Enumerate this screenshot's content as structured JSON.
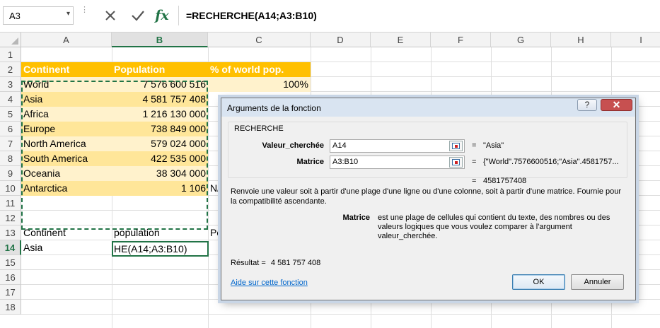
{
  "formula_bar": {
    "name_box": "A3",
    "formula": "=RECHERCHE(A14;A3:B10)"
  },
  "icons": {
    "name_box_dropdown": "▾",
    "cancel": "✕",
    "enter": "✓",
    "fx": "fx",
    "dots": "⋮"
  },
  "columns": [
    "A",
    "B",
    "C",
    "D",
    "E",
    "F",
    "G",
    "H",
    "I"
  ],
  "rows": [
    "1",
    "2",
    "3",
    "4",
    "5",
    "6",
    "7",
    "8",
    "9",
    "10",
    "11",
    "12",
    "13",
    "14",
    "15",
    "16",
    "17",
    "18"
  ],
  "table": {
    "headers": [
      "Continent",
      "Population",
      "% of world pop."
    ],
    "rows": [
      {
        "continent": "World",
        "population": "7 576 600 516",
        "percent": "100%"
      },
      {
        "continent": "Asia",
        "population": "4 581 757 408",
        "percent": ""
      },
      {
        "continent": "Africa",
        "population": "1 216 130 000",
        "percent": ""
      },
      {
        "continent": "Europe",
        "population": "738 849 000",
        "percent": ""
      },
      {
        "continent": "North America",
        "population": "579 024 000",
        "percent": ""
      },
      {
        "continent": "South America",
        "population": "422 535 000",
        "percent": ""
      },
      {
        "continent": "Oceania",
        "population": "38 304 000",
        "percent": ""
      },
      {
        "continent": "Antarctica",
        "population": "1 106",
        "percent": "N/"
      }
    ],
    "colors": {
      "header": "#ffc000",
      "band_light": "#fff2cc",
      "band_dark": "#ffe699"
    }
  },
  "lookup": {
    "label_continent": "Continent",
    "label_population": "population",
    "label_c13": "Po",
    "value_continent": "Asia",
    "active_cell_text": "HE(A14;A3:B10)"
  },
  "dialog": {
    "title": "Arguments de la fonction",
    "help_button": "?",
    "close_button": "✕",
    "function_name": "RECHERCHE",
    "args": [
      {
        "label": "Valeur_cherchée",
        "input": "A14",
        "value": "\"Asia\""
      },
      {
        "label": "Matrice",
        "input": "A3:B10",
        "value": "{\"World\".7576600516;\"Asia\".4581757..."
      }
    ],
    "equals": "=",
    "result_value": "4581757408",
    "description": "Renvoie une valeur soit à partir d'une plage d'une ligne ou d'une colonne, soit à partir d'une matrice. Fournie pour la compatibilité ascendante.",
    "arg_desc_name": "Matrice",
    "arg_desc_text": "est une plage de cellules qui contient du texte, des nombres ou des valeurs logiques que vous voulez comparer à l'argument valeur_cherchée.",
    "result_label": "Résultat =",
    "result_formatted": "4 581 757 408",
    "help_link": "Aide sur cette fonction",
    "ok": "OK",
    "cancel": "Annuler"
  }
}
